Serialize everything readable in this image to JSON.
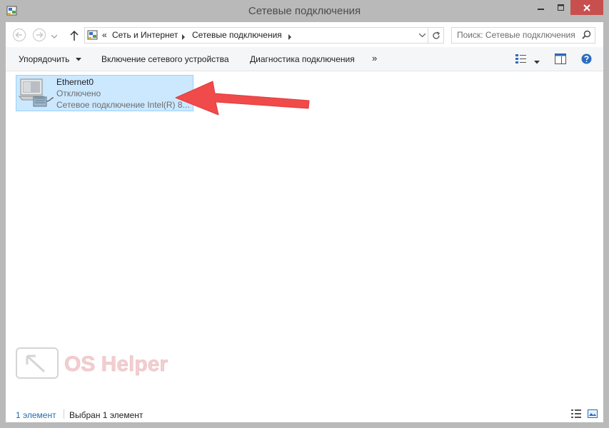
{
  "window": {
    "title": "Сетевые подключения"
  },
  "address": {
    "prefix": "«",
    "crumbs": [
      "Сеть и Интернет",
      "Сетевые подключения"
    ]
  },
  "search": {
    "placeholder": "Поиск: Сетевые подключения"
  },
  "toolbar": {
    "organize": "Упорядочить",
    "enable_device": "Включение сетевого устройства",
    "diagnose": "Диагностика подключения",
    "more": "»"
  },
  "items": [
    {
      "name": "Ethernet0",
      "status": "Отключено",
      "device": "Сетевое подключение Intel(R) 8..."
    }
  ],
  "watermark": {
    "text": "OS Helper"
  },
  "status": {
    "count": "1 элемент",
    "selected": "Выбран 1 элемент"
  },
  "colors": {
    "selection_bg": "#cce8ff",
    "selection_border": "#99d1ff",
    "close_button": "#c7504f",
    "arrow": "#f04a4a"
  },
  "icons": [
    "network-connections-icon",
    "minimize-icon",
    "maximize-icon",
    "close-icon",
    "back-arrow-icon",
    "forward-arrow-icon",
    "up-arrow-icon",
    "refresh-icon",
    "search-icon",
    "help-icon",
    "ethernet-adapter-icon"
  ]
}
